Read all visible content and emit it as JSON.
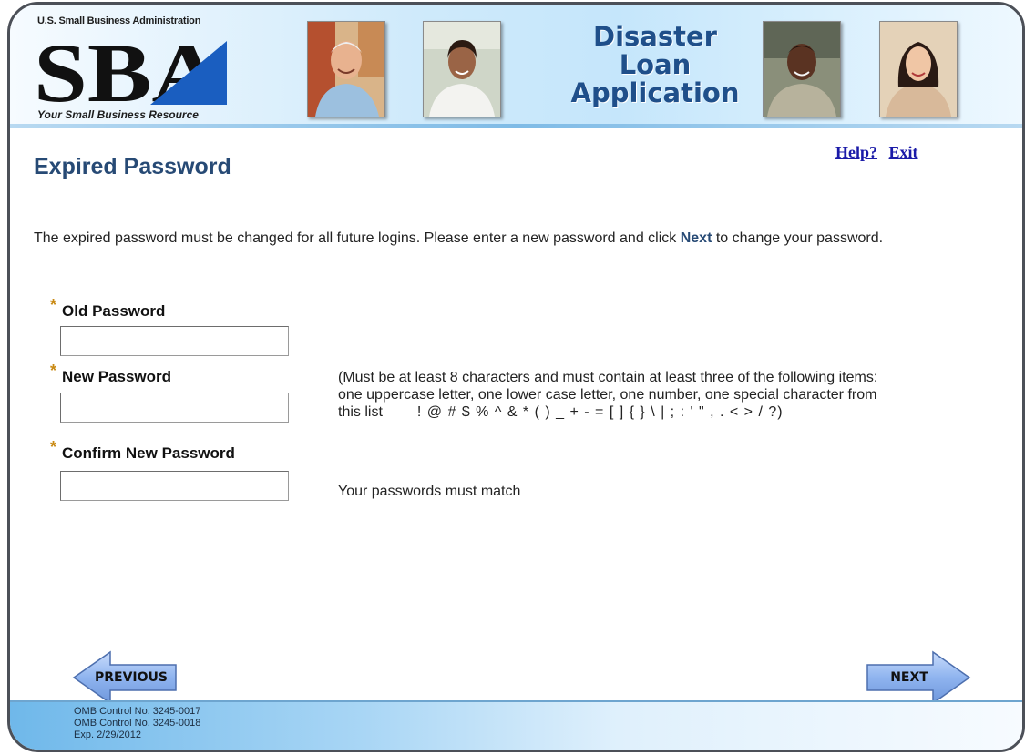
{
  "header": {
    "logo_top": "U.S. Small Business Administration",
    "logo_tagline": "Your Small Business Resource",
    "title_lines": [
      "Disaster",
      "Loan",
      "Application"
    ]
  },
  "links": {
    "help": "Help?",
    "exit": "Exit"
  },
  "page_title": "Expired Password",
  "intro": {
    "before": "The expired password must be changed for all future logins.  Please enter a new password and click ",
    "next_word": "Next",
    "after": " to change your password."
  },
  "fields": {
    "required_marker": "*",
    "old_password": {
      "label": "Old Password",
      "value": ""
    },
    "new_password": {
      "label": "New Password",
      "value": ""
    },
    "confirm_password": {
      "label": "Confirm New Password",
      "value": ""
    }
  },
  "rules": {
    "line1": "(Must be at least 8 characters and must contain at least three of the following items:",
    "line2": "one uppercase letter, one lower case letter, one number, one special character from",
    "line3_prefix": "this list",
    "specials": "! @ # $ % ^ & * ( ) _ + - = [ ] { } \\ | ; : ' \" , . < > / ?)",
    "match_note": "Your passwords must match"
  },
  "nav": {
    "previous_label": "PREVIOUS",
    "next_label": "NEXT"
  },
  "footer": {
    "lines": [
      "OMB Control No. 3245-0017",
      "OMB Control No. 3245-0018",
      "Exp. 2/29/2012"
    ]
  },
  "colors": {
    "title_blue": "#274a75",
    "link_blue": "#1a1aa8",
    "required_gold": "#c98a14",
    "divider_gold": "#d7b25a",
    "arrow_blue": "#8fb4ef"
  },
  "icons": [
    "sba-logo",
    "person-photo",
    "arrow-left-icon",
    "arrow-right-icon"
  ]
}
